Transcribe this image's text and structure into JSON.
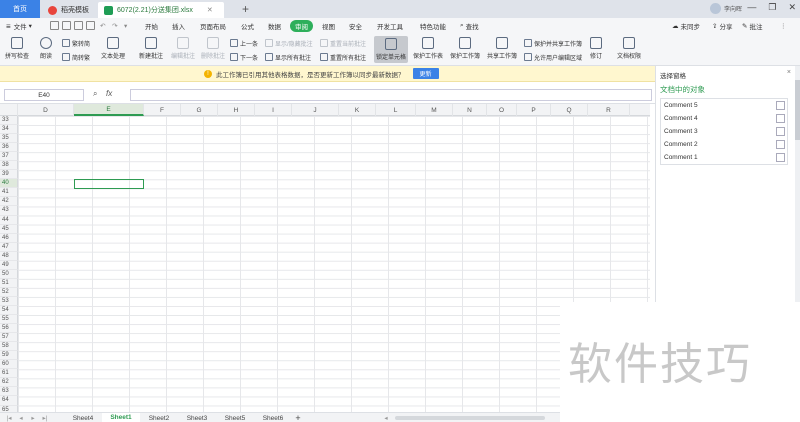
{
  "titlebar": {
    "home_tab": "首页",
    "template_tab": "稻壳模板",
    "file_tab": "6072(2.21)分送集团.xlsx",
    "add_tab": "+",
    "user_name": "李向晖",
    "window_buttons": [
      "—",
      "❐",
      "✕"
    ]
  },
  "menubar": {
    "file_menu": "文件",
    "items": [
      "开始",
      "插入",
      "页面布局",
      "公式",
      "数据",
      "审阅",
      "视图",
      "安全",
      "开发工具",
      "特色功能"
    ],
    "active_item": "审阅",
    "search": "查找",
    "sync": "未同步",
    "share": "分享",
    "comment": "批注"
  },
  "ribbon": {
    "spell_check": "拼写检查",
    "read_aloud": "朗读",
    "trad_to_simp": "繁转简",
    "simp_to_trad": "简转繁",
    "text_process": "文本处理",
    "new_comment": "新建批注",
    "edit_comment": "编辑批注",
    "delete_comment": "删除批注",
    "prev": "上一条",
    "next": "下一条",
    "show_hide_comment": "显示/隐藏批注",
    "show_all_comments": "显示所有批注",
    "reset_comment": "重置当前批注",
    "reset_all_comments": "重置所有批注",
    "lock_cells": "锁定单元格",
    "protect_sheet": "保护工作表",
    "protect_workbook": "保护工作簿",
    "share_workbook": "共享工作簿",
    "protect_and_share": "保护并共享工作簿",
    "allow_edit_ranges": "允许用户编辑区域",
    "revise": "修订",
    "doc_rights": "文档权限"
  },
  "notice": {
    "message": "此工作簿已引用其他表格数据，是否更新工作簿以同步最新数据？",
    "button": "更新"
  },
  "formula_bar": {
    "name_box": "E40",
    "fx": "fx",
    "value": ""
  },
  "grid": {
    "columns": [
      "D",
      "E",
      "F",
      "G",
      "H",
      "I",
      "J",
      "K",
      "L",
      "M",
      "N",
      "O",
      "P",
      "Q",
      "R"
    ],
    "selected_column": "E",
    "rows": [
      "33",
      "34",
      "35",
      "36",
      "37",
      "38",
      "39",
      "40",
      "41",
      "42",
      "43",
      "44",
      "45",
      "46",
      "47",
      "48",
      "49",
      "50",
      "51",
      "52",
      "53",
      "54",
      "55",
      "56",
      "57",
      "58",
      "59",
      "60",
      "61",
      "62",
      "63",
      "64",
      "65"
    ],
    "selected_row": "40",
    "selected_cell": "E40"
  },
  "sheets": {
    "tabs": [
      "Sheet4",
      "Sheet1",
      "Sheet2",
      "Sheet3",
      "Sheet5",
      "Sheet6"
    ],
    "active": "Sheet1",
    "add": "+"
  },
  "panel": {
    "title": "选择窗格",
    "close": "×",
    "subtitle": "文档中的对象",
    "items": [
      "Comment 5",
      "Comment 4",
      "Comment 3",
      "Comment 2",
      "Comment 1"
    ]
  },
  "watermark": "软件技巧"
}
